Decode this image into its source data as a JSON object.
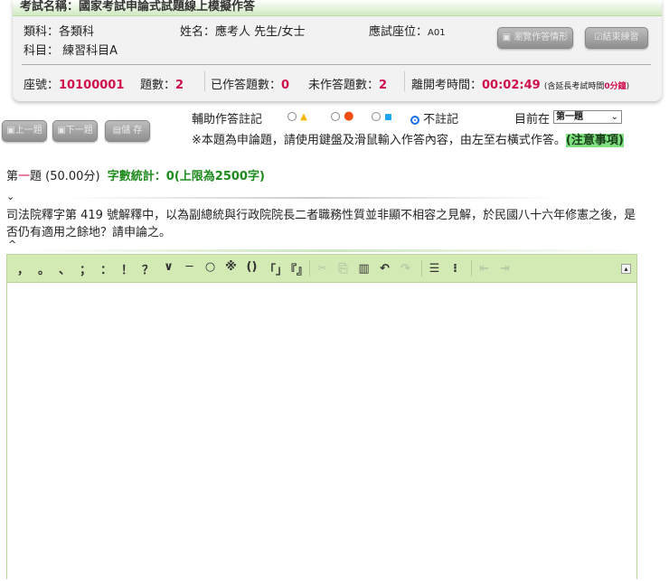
{
  "header": {
    "exam_name_label": "考試名稱：",
    "exam_name": "國家考試申論式試題線上模擬作答",
    "category": "類科：各類科",
    "name": "姓名：應考人 先生/女士",
    "seat_label": "應試座位：",
    "seat": "A01",
    "subject": "科目： 練習科目A",
    "review_button": "瀏覽作答情形",
    "finish_button": "結束練習",
    "seat_no_label": "座號：",
    "seat_no": "10100001",
    "count_label": "題數：",
    "count": "2",
    "answered_label": "已作答題數：",
    "answered": "0",
    "unanswered_label": "未作答題數：",
    "unanswered": "2",
    "time_label": "離開考時間：",
    "time": "00:02:49",
    "ext_prefix": "(含延長考試時間",
    "ext_value": "0分鐘",
    "ext_suffix": ")"
  },
  "nav": {
    "prev": "上一題",
    "next": "下一題",
    "save": "儲 存"
  },
  "mark": {
    "label": "輔助作答註記",
    "none": "不註記",
    "current_label": "目前在",
    "current": "第一題",
    "notice": "※本題為申論題，請使用鍵盤及滑鼠輸入作答內容，由左至右橫式作答。",
    "notice_link": "(注意事項)"
  },
  "question": {
    "prefix": "第",
    "num": "一",
    "suffix": "題 (50.00分)",
    "wordcount": "字數統計：0(上限為2500字)",
    "text": "司法院釋字第 419 號解釋中，以為副總統與行政院院長二者職務性質並非顯不相容之見解，於民國八十六年修憲之後，是否仍有適用之餘地？請申論之。"
  },
  "toolbar": {
    "punct": [
      "，",
      "。",
      "、",
      "；",
      "：",
      "！",
      "？",
      "∨",
      "─",
      "○",
      "※",
      "()",
      "「」",
      "『』"
    ]
  },
  "colors": {
    "accent_red": "#d0104c",
    "green": "#1e8a1e",
    "toolbar": "#d4eab4"
  }
}
